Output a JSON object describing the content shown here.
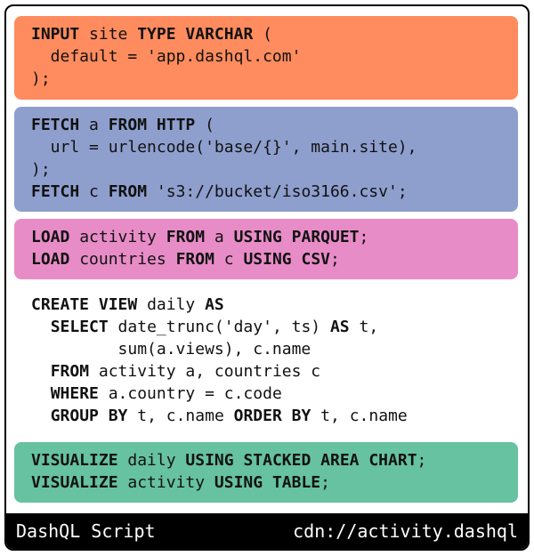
{
  "blocks": [
    {
      "name": "input-block",
      "color": "#ff8c5e",
      "lines": [
        [
          {
            "t": "INPUT",
            "kw": true
          },
          {
            "t": " site "
          },
          {
            "t": "TYPE",
            "kw": true
          },
          {
            "t": " "
          },
          {
            "t": "VARCHAR",
            "kw": true
          },
          {
            "t": " ("
          }
        ],
        [
          {
            "t": "  default = 'app.dashql.com'"
          }
        ],
        [
          {
            "t": ");"
          }
        ]
      ]
    },
    {
      "name": "fetch-block",
      "color": "#8e9fce",
      "lines": [
        [
          {
            "t": "FETCH",
            "kw": true
          },
          {
            "t": " a "
          },
          {
            "t": "FROM",
            "kw": true
          },
          {
            "t": " "
          },
          {
            "t": "HTTP",
            "kw": true
          },
          {
            "t": " ("
          }
        ],
        [
          {
            "t": "  url = urlencode('base/{}', main.site),"
          }
        ],
        [
          {
            "t": ");"
          }
        ],
        [
          {
            "t": "FETCH",
            "kw": true
          },
          {
            "t": " c "
          },
          {
            "t": "FROM",
            "kw": true
          },
          {
            "t": " 's3://bucket/iso3166.csv';"
          }
        ]
      ]
    },
    {
      "name": "load-block",
      "color": "#e88cc7",
      "lines": [
        [
          {
            "t": "LOAD",
            "kw": true
          },
          {
            "t": " activity "
          },
          {
            "t": "FROM",
            "kw": true
          },
          {
            "t": " a "
          },
          {
            "t": "USING",
            "kw": true
          },
          {
            "t": " "
          },
          {
            "t": "PARQUET",
            "kw": true
          },
          {
            "t": ";"
          }
        ],
        [
          {
            "t": "LOAD",
            "kw": true
          },
          {
            "t": " countries "
          },
          {
            "t": "FROM",
            "kw": true
          },
          {
            "t": " c "
          },
          {
            "t": "USING",
            "kw": true
          },
          {
            "t": " "
          },
          {
            "t": "CSV",
            "kw": true
          },
          {
            "t": ";"
          }
        ]
      ]
    },
    {
      "name": "view-block",
      "color": "#ffffff",
      "lines": [
        [
          {
            "t": "CREATE",
            "kw": true
          },
          {
            "t": " "
          },
          {
            "t": "VIEW",
            "kw": true
          },
          {
            "t": " daily "
          },
          {
            "t": "AS",
            "kw": true
          }
        ],
        [
          {
            "t": "  "
          },
          {
            "t": "SELECT",
            "kw": true
          },
          {
            "t": " date_trunc('day', ts) "
          },
          {
            "t": "AS",
            "kw": true
          },
          {
            "t": " t,"
          }
        ],
        [
          {
            "t": "         sum(a.views), c.name"
          }
        ],
        [
          {
            "t": "  "
          },
          {
            "t": "FROM",
            "kw": true
          },
          {
            "t": " activity a, countries c"
          }
        ],
        [
          {
            "t": "  "
          },
          {
            "t": "WHERE",
            "kw": true
          },
          {
            "t": " a.country = c.code"
          }
        ],
        [
          {
            "t": "  "
          },
          {
            "t": "GROUP",
            "kw": true
          },
          {
            "t": " "
          },
          {
            "t": "BY",
            "kw": true
          },
          {
            "t": " t, c.name "
          },
          {
            "t": "ORDER",
            "kw": true
          },
          {
            "t": " "
          },
          {
            "t": "BY",
            "kw": true
          },
          {
            "t": " t, c.name"
          }
        ]
      ]
    },
    {
      "name": "visualize-block",
      "color": "#66c2a0",
      "lines": [
        [
          {
            "t": "VISUALIZE",
            "kw": true
          },
          {
            "t": " daily "
          },
          {
            "t": "USING",
            "kw": true
          },
          {
            "t": " "
          },
          {
            "t": "STACKED",
            "kw": true
          },
          {
            "t": " "
          },
          {
            "t": "AREA",
            "kw": true
          },
          {
            "t": " "
          },
          {
            "t": "CHART",
            "kw": true
          },
          {
            "t": ";"
          }
        ],
        [
          {
            "t": "VISUALIZE",
            "kw": true
          },
          {
            "t": " activity "
          },
          {
            "t": "USING",
            "kw": true
          },
          {
            "t": " "
          },
          {
            "t": "TABLE",
            "kw": true
          },
          {
            "t": ";"
          }
        ]
      ]
    }
  ],
  "footer": {
    "title": "DashQL Script",
    "path": "cdn://activity.dashql"
  }
}
